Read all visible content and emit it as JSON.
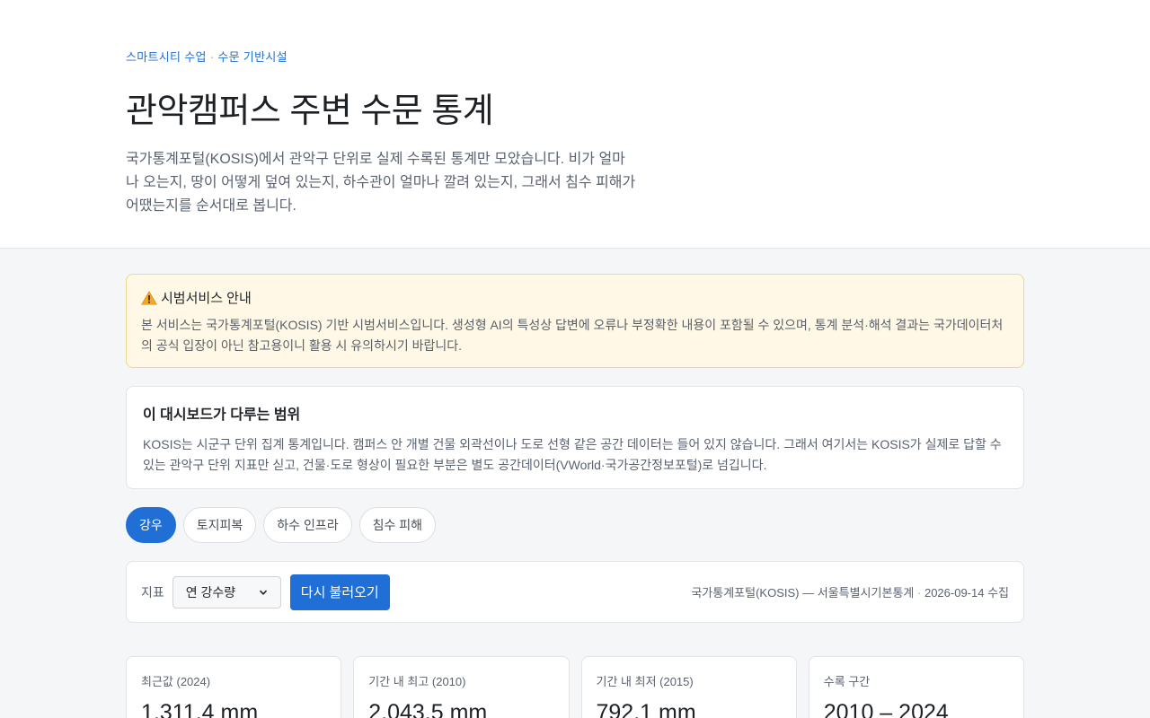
{
  "hero": {
    "eyebrow_a": "스마트시티 수업",
    "eyebrow_sep": "·",
    "eyebrow_b": "수문 기반시설",
    "title": "관악캠퍼스 주변 수문 통계",
    "intro": "국가통계포털(KOSIS)에서 관악구 단위로 실제 수록된 통계만 모았습니다. 비가 얼마나 오는지, 땅이 어떻게 덮여 있는지, 하수관이 얼마나 깔려 있는지, 그래서 침수 피해가 어땠는지를 순서대로 봅니다."
  },
  "notice": {
    "icon": "warning-icon",
    "title": "시범서비스 안내",
    "body": "본 서비스는 국가통계포털(KOSIS) 기반 시범서비스입니다. 생성형 AI의 특성상 답변에 오류나 부정확한 내용이 포함될 수 있으며, 통계 분석·해석 결과는 국가데이터처의 공식 입장이 아닌 참고용이니 활용 시 유의하시기 바랍니다."
  },
  "scope": {
    "title": "이 대시보드가 다루는 범위",
    "body": "KOSIS는 시군구 단위 집계 통계입니다. 캠퍼스 안 개별 건물 외곽선이나 도로 선형 같은 공간 데이터는 들어 있지 않습니다. 그래서 여기서는 KOSIS가 실제로 답할 수 있는 관악구 단위 지표만 싣고, 건물·도로 형상이 필요한 부분은 별도 공간데이터(VWorld·국가공간정보포털)로 넘깁니다."
  },
  "tabs": [
    {
      "label": "강우",
      "active": true
    },
    {
      "label": "토지피복",
      "active": false
    },
    {
      "label": "하수 인프라",
      "active": false
    },
    {
      "label": "침수 피해",
      "active": false
    }
  ],
  "controls": {
    "indicator_label": "지표",
    "indicator_value": "연 강수량",
    "reload_label": "다시 불러오기",
    "source_text": "국가통계포털(KOSIS) — 서울특별시기본통계",
    "source_sep": "·",
    "collected": "2026-09-14 수집"
  },
  "stats": [
    {
      "label": "최근값 (2024)",
      "value": "1,311.4 mm"
    },
    {
      "label": "기간 내 최고 (2010)",
      "value": "2,043.5 mm"
    },
    {
      "label": "기간 내 최저 (2015)",
      "value": "792.1 mm"
    },
    {
      "label": "수록 구간",
      "value": "2010 – 2024"
    }
  ],
  "colors": {
    "accent": "#1f6fd6",
    "notice_bg": "#fff8e6",
    "notice_border": "#f0d98c",
    "warning": "#f5a623"
  }
}
